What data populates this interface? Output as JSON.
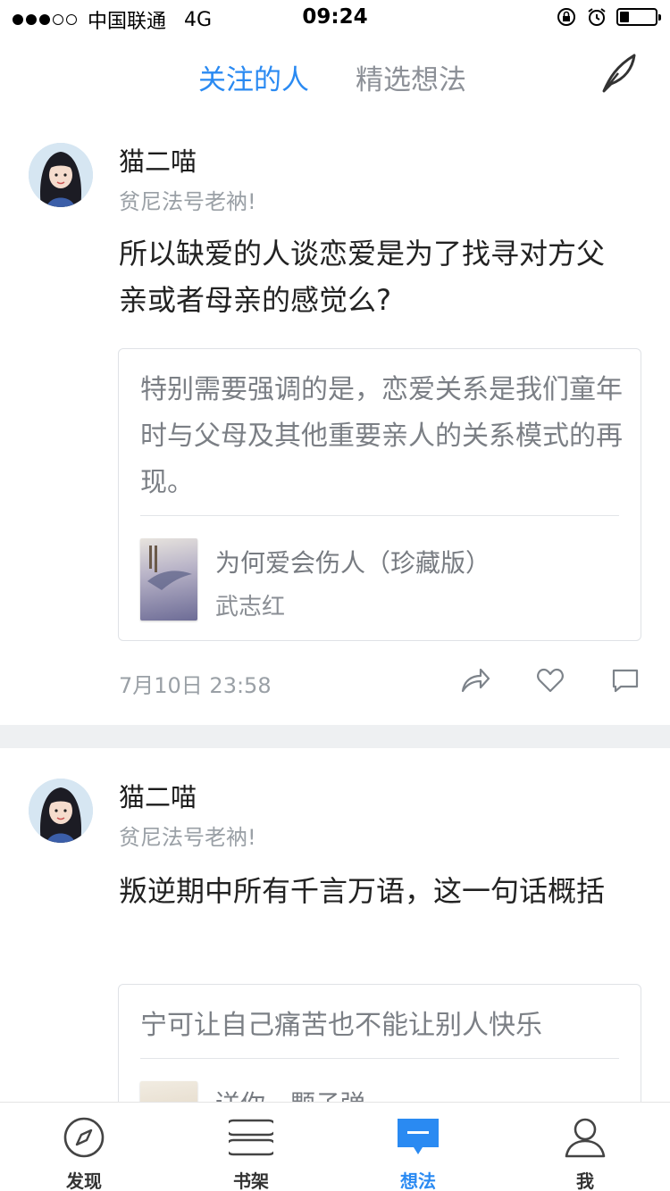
{
  "status_bar": {
    "carrier": "中国联通",
    "network": "4G",
    "time": "09:24",
    "signal_bars": 3,
    "signal_total": 5,
    "battery_level": 0.25
  },
  "header": {
    "tabs": [
      {
        "label": "关注的人",
        "active": true
      },
      {
        "label": "精选想法",
        "active": false
      }
    ],
    "compose_icon": "quill-icon"
  },
  "posts": [
    {
      "user": {
        "name": "猫二喵",
        "signature": "贫尼法号老衲!"
      },
      "content": "所以缺爱的人谈恋爱是为了找寻对方父亲或者母亲的感觉么?",
      "quote": {
        "text": "特别需要强调的是，恋爱关系是我们童年时与父母及其他重要亲人的关系模式的再现。",
        "book_title": "为何爱会伤人（珍藏版）",
        "book_author": "武志红"
      },
      "timestamp": "7月10日 23:58",
      "actions": [
        "share-icon",
        "like-icon",
        "comment-icon"
      ]
    },
    {
      "user": {
        "name": "猫二喵",
        "signature": "贫尼法号老衲!"
      },
      "content": "叛逆期中所有千言万语，这一句话概括",
      "quote": {
        "text": "宁可让自己痛苦也不能让别人快乐",
        "book_title": "送你一颗子弹",
        "book_author": ""
      }
    }
  ],
  "bottom_nav": [
    {
      "label": "发现",
      "icon": "compass-icon",
      "active": false
    },
    {
      "label": "书架",
      "icon": "bookshelf-icon",
      "active": false
    },
    {
      "label": "想法",
      "icon": "thought-bubble-icon",
      "active": true
    },
    {
      "label": "我",
      "icon": "person-icon",
      "active": false
    }
  ],
  "colors": {
    "accent": "#2a8af2",
    "muted_text": "#9aa0a6",
    "separator": "#eef0f2"
  }
}
